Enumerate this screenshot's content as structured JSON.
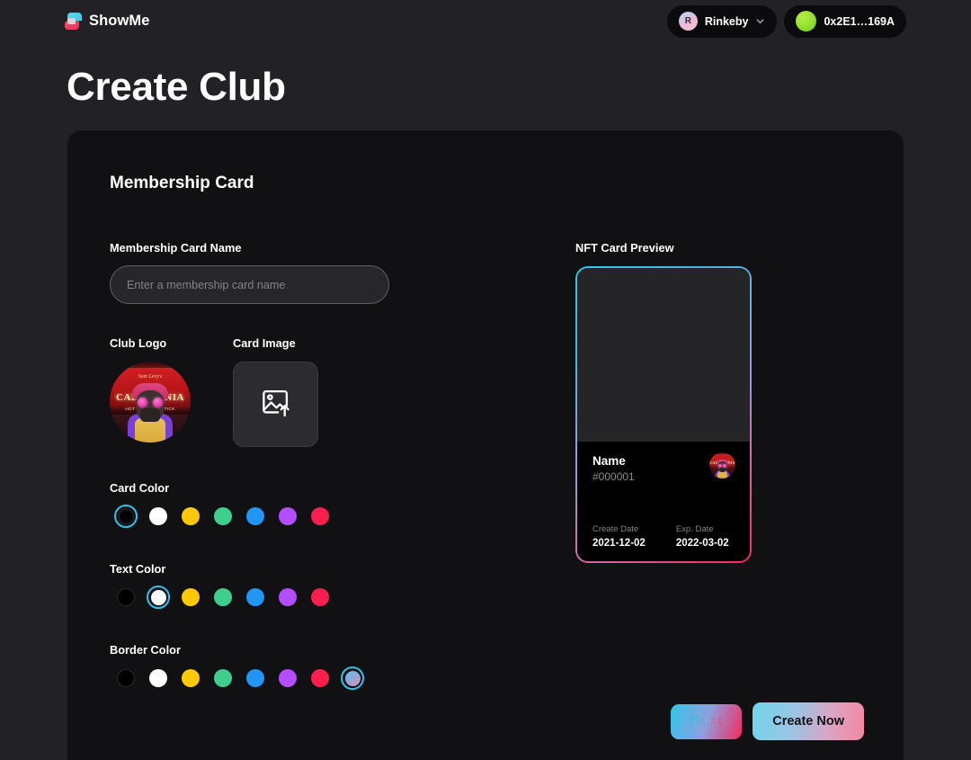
{
  "nav": {
    "brand": "ShowMe",
    "brand_icon": "showme-logo-icon",
    "network": {
      "label": "Rinkeby",
      "avatar_letter": "R",
      "chevron_icon": "chevron-down-icon"
    },
    "wallet": {
      "address": "0x2E1…169A",
      "status_dot_color": "#8ddc2b"
    }
  },
  "page": {
    "title": "Create Club"
  },
  "panel": {
    "title": "Membership Card"
  },
  "form": {
    "card_name": {
      "label": "Membership Card Name",
      "value": "",
      "placeholder": "Enter a membership card name"
    },
    "club_logo": {
      "label": "Club Logo",
      "image_alt": "club-logo-nft-avatar",
      "art": {
        "sign_text": "CALIFORNIA",
        "sign_sub": "HOT DOG ON A STICK",
        "script_text": "Sam Levy's"
      }
    },
    "card_image": {
      "label": "Card Image",
      "upload_icon": "image-upload-icon",
      "value": ""
    },
    "card_color": {
      "label": "Card Color",
      "selected_index": 0,
      "swatches": [
        {
          "name": "black",
          "hex": "#000000"
        },
        {
          "name": "white",
          "hex": "#ffffff"
        },
        {
          "name": "gold",
          "hex": "#FFC907"
        },
        {
          "name": "green",
          "hex": "#3ECF8E"
        },
        {
          "name": "blue",
          "hex": "#2196F3"
        },
        {
          "name": "purple",
          "hex": "#B44DFF"
        },
        {
          "name": "pink",
          "hex": "#FA1E4E"
        }
      ]
    },
    "text_color": {
      "label": "Text Color",
      "selected_index": 1,
      "swatches": [
        {
          "name": "black",
          "hex": "#000000"
        },
        {
          "name": "white",
          "hex": "#ffffff"
        },
        {
          "name": "gold",
          "hex": "#FFC907"
        },
        {
          "name": "green",
          "hex": "#3ECF8E"
        },
        {
          "name": "blue",
          "hex": "#2196F3"
        },
        {
          "name": "purple",
          "hex": "#B44DFF"
        },
        {
          "name": "pink",
          "hex": "#FA1E4E"
        }
      ]
    },
    "border_color": {
      "label": "Border Color",
      "selected_index": 7,
      "swatches": [
        {
          "name": "black",
          "hex": "#000000"
        },
        {
          "name": "white",
          "hex": "#ffffff"
        },
        {
          "name": "gold",
          "hex": "#FFC907"
        },
        {
          "name": "green",
          "hex": "#3ECF8E"
        },
        {
          "name": "blue",
          "hex": "#2196F3"
        },
        {
          "name": "purple",
          "hex": "#B44DFF"
        },
        {
          "name": "pink",
          "hex": "#FA1E4E"
        },
        {
          "name": "gradient",
          "hex": "linear-gradient(145deg,#5ec8ea 0%,#8fa6dd 45%,#e88fa8 100%)"
        }
      ]
    }
  },
  "preview": {
    "label": "NFT Card Preview",
    "card": {
      "name": "Name",
      "token_id": "#000001",
      "create_date_label": "Create Date",
      "create_date_value": "2021-12-02",
      "exp_date_label": "Exp. Date",
      "exp_date_value": "2022-03-02",
      "border_gradient": "linear-gradient(150deg,#2ec7e8 0%,#8f9fe0 48%,#f8285e 100%)"
    }
  },
  "actions": {
    "back_label": "Back",
    "create_label": "Create Now"
  }
}
